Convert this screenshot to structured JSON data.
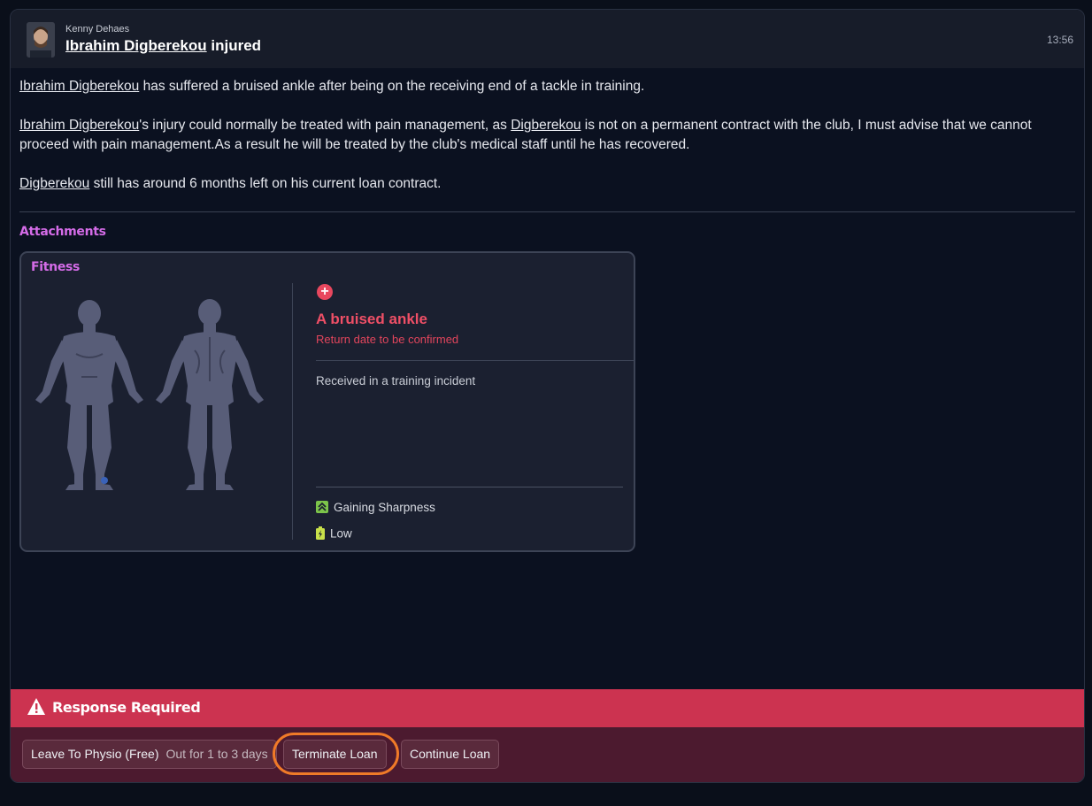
{
  "header": {
    "sender": "Kenny Dehaes",
    "subject_player": "Ibrahim Digberekou",
    "subject_suffix": " injured",
    "time": "13:56"
  },
  "message": {
    "p1": {
      "player": "Ibrahim Digberekou",
      "text": " has suffered a bruised ankle after being on the receiving end of a tackle in training."
    },
    "p2": {
      "player": "Ibrahim Digberekou",
      "text_a": "'s injury could normally be treated with pain management, as ",
      "player_short": "Digberekou",
      "text_b": " is not on a permanent contract with the club, I must advise that we cannot proceed with pain management.As a result he will be treated by the club's medical staff until he has recovered."
    },
    "p3": {
      "player_short": "Digberekou",
      "text": " still has around 6 months left on his current loan contract."
    }
  },
  "attachments": {
    "label": "Attachments",
    "card": {
      "title": "Fitness",
      "injury_name": "A bruised ankle",
      "return_date": "Return date to be confirmed",
      "received": "Received in a training incident",
      "sharpness": "Gaining Sharpness",
      "condition": "Low",
      "icons": {
        "injury": "plus-circle-icon",
        "sharpness": "chevron-up-icon",
        "condition": "battery-icon"
      }
    }
  },
  "response": {
    "label": "Response Required",
    "buttons": {
      "physio": "Leave To Physio (Free)",
      "physio_sub": "Out for 1 to 3 days",
      "terminate": "Terminate Loan",
      "continue": "Continue Loan"
    }
  },
  "colors": {
    "accent_purple": "#d56ce8",
    "injury_red": "#ef4f66",
    "response_bar": "#cc3350",
    "highlight_ring": "#f07a28"
  }
}
